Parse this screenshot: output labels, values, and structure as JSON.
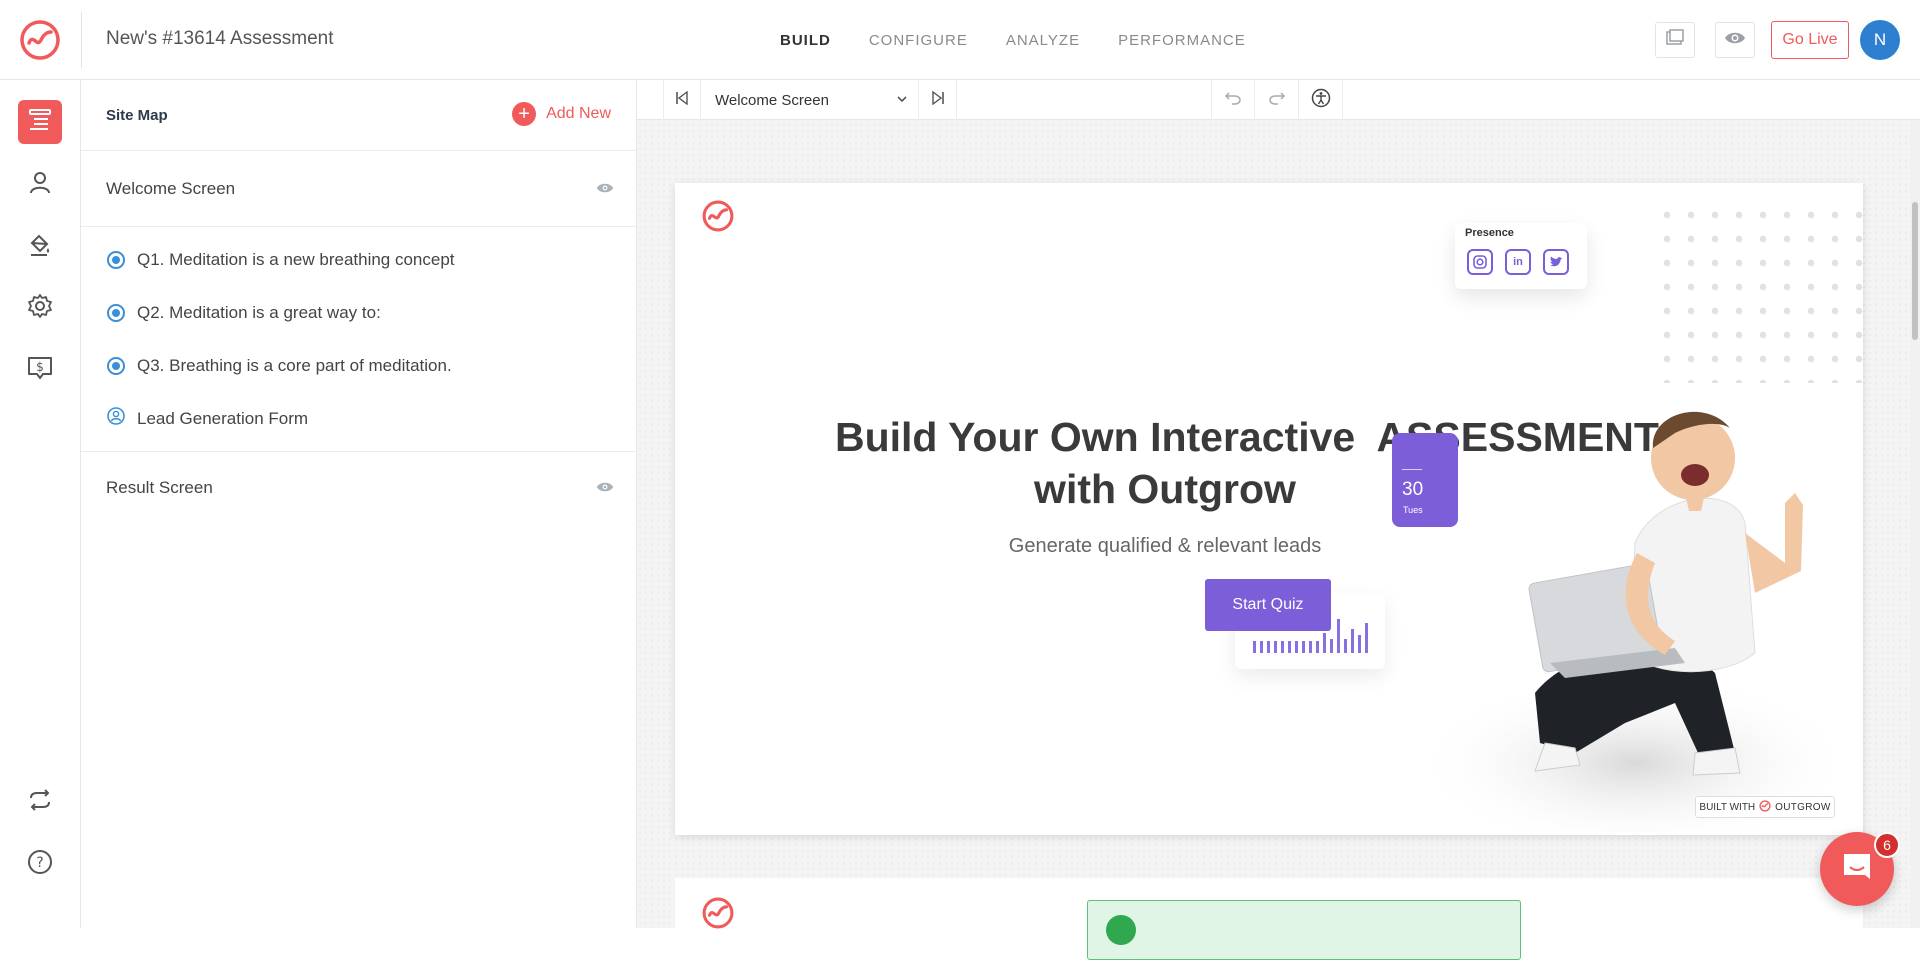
{
  "app": {
    "title": "New's #13614 Assessment"
  },
  "nav": {
    "items": [
      {
        "label": "BUILD",
        "active": true
      },
      {
        "label": "CONFIGURE",
        "active": false
      },
      {
        "label": "ANALYZE",
        "active": false
      },
      {
        "label": "PERFORMANCE",
        "active": false
      }
    ]
  },
  "header": {
    "toggle_icon": "layout-icon",
    "preview_icon": "eye-icon",
    "go_live_label": "Go Live",
    "avatar_initial": "N"
  },
  "rail": {
    "items": [
      "site-map-icon",
      "user-icon",
      "paint-bucket-icon",
      "gear-icon",
      "pricing-icon"
    ],
    "bottom": [
      "sync-icon",
      "help-icon"
    ]
  },
  "sitemap": {
    "title": "Site Map",
    "add_new_label": "Add New",
    "welcome_label": "Welcome Screen",
    "questions": [
      "Q1. Meditation is a new breathing concept",
      "Q2. Meditation is a great way to:",
      "Q3. Breathing is a core part of meditation."
    ],
    "lead_form_label": "Lead Generation Form",
    "result_label": "Result Screen"
  },
  "toolbar": {
    "selected_screen": "Welcome Screen"
  },
  "preview": {
    "headline_line1": "Build Your Own Interactive  ASSESSMENT",
    "headline_line2": "with Outgrow",
    "subheadline": "Generate qualified & relevant leads",
    "cta_label": "Start Quiz",
    "presence_title": "Presence",
    "calendar_day_num": "30",
    "calendar_day_name": "Tues",
    "built_with_label": "BUILT WITH",
    "built_with_brand": "OUTGROW"
  },
  "chat": {
    "badge_count": "6"
  },
  "colors": {
    "accent": "#f05a5a",
    "purple": "#7b5ed8",
    "blue": "#3a8fd8"
  }
}
